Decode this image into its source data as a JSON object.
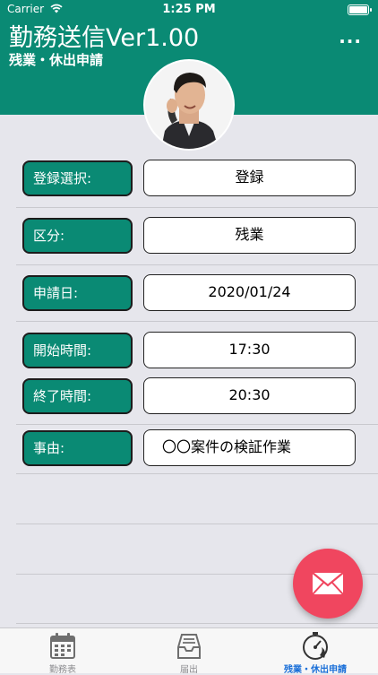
{
  "status_bar": {
    "carrier": "Carrier",
    "time": "1:25 PM"
  },
  "header": {
    "title": "勤務送信Ver1.00",
    "subtitle": "残業・休出申請",
    "more_label": "···"
  },
  "form": {
    "rows": [
      {
        "label": "登録選択:",
        "value": "登録"
      },
      {
        "label": "区分:",
        "value": "残業"
      },
      {
        "label": "申請日:",
        "value": "2020/01/24"
      },
      {
        "label": "開始時間:",
        "value": "17:30"
      },
      {
        "label": "終了時間:",
        "value": "20:30"
      },
      {
        "label": "事由:",
        "value": "〇〇案件の検証作業"
      }
    ]
  },
  "tabs": [
    {
      "label": "勤務表",
      "icon": "calendar-icon"
    },
    {
      "label": "届出",
      "icon": "inbox-tray-icon"
    },
    {
      "label": "残業・休出申請",
      "icon": "stopwatch-icon"
    }
  ],
  "colors": {
    "accent": "#0a8a74",
    "fab": "#f0465f",
    "active_tab": "#1a6fd8"
  }
}
